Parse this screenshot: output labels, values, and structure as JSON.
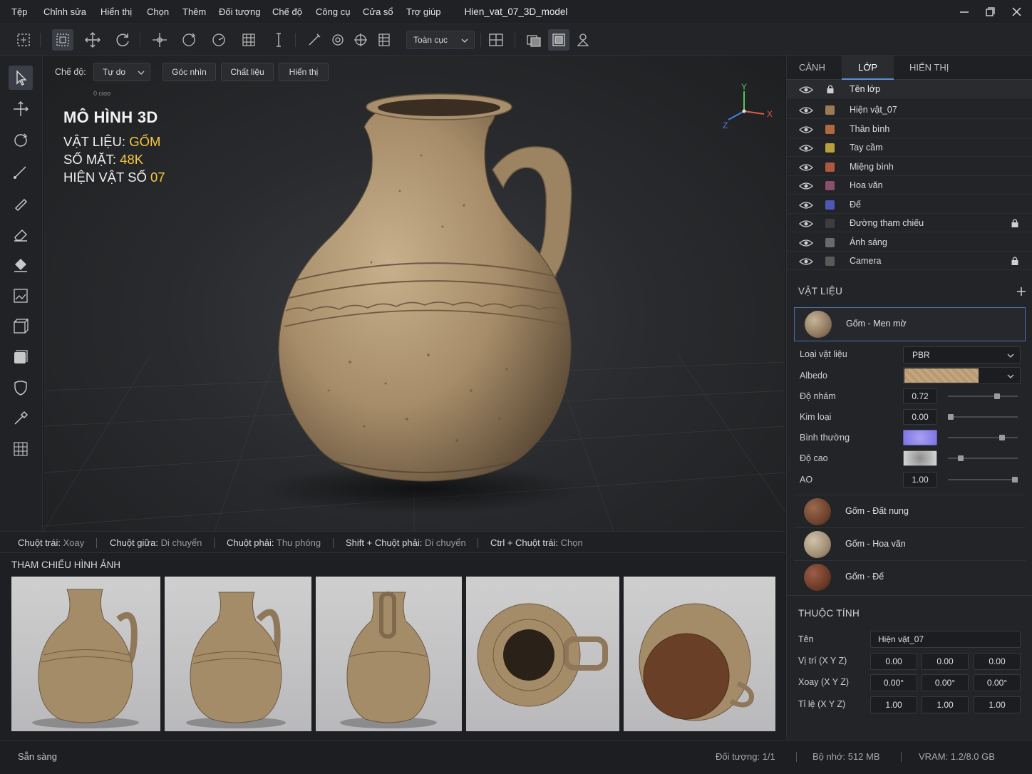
{
  "menubar": {
    "items": [
      "Tệp",
      "Chỉnh sửa",
      "Hiển thị",
      "Chọn",
      "Thêm",
      "Đối tượng",
      "Chế độ",
      "Công cụ",
      "Cửa sổ",
      "Trợ giúp"
    ],
    "title": "Hien_vat_07_3D_model"
  },
  "toolbar": {
    "scope_value": "Toàn cục"
  },
  "viewport": {
    "mode_label": "Chế độ:",
    "mode_value": "Tự do",
    "buttons": [
      "Góc nhìn",
      "Chất liệu",
      "Hiển thị"
    ],
    "small_text": "0 cioo",
    "info": {
      "title": "MÔ HÌNH 3D",
      "material_label": "VẬT LIỆU:",
      "material_value": "GỐM",
      "faces_label": "SỐ MẶT:",
      "faces_value": "48K",
      "artifact_label": "HIỆN VẬT SỐ",
      "artifact_value": "07"
    },
    "axes": {
      "x": "X",
      "y": "Y",
      "z": "Z"
    }
  },
  "hints": [
    {
      "key": "Chuột trái:",
      "action": "Xoay"
    },
    {
      "key": "Chuột giữa:",
      "action": "Di chuyển"
    },
    {
      "key": "Chuột phải:",
      "action": "Thu phóng"
    },
    {
      "key": "Shift + Chuột phải:",
      "action": "Di chuyển"
    },
    {
      "key": "Ctrl + Chuột trái:",
      "action": "Chọn"
    }
  ],
  "references": {
    "title": "THAM CHIẾU HÌNH ẢNH"
  },
  "panel": {
    "tabs": [
      "CẢNH",
      "LỚP",
      "HIỂN THỊ"
    ],
    "layer_header": "Tên lớp",
    "layers": [
      {
        "name": "Hiện vật_07",
        "color": "#9c7a55",
        "locked": false
      },
      {
        "name": "Thân bình",
        "color": "#b0683e",
        "locked": false
      },
      {
        "name": "Tay cầm",
        "color": "#b8a13a",
        "locked": false
      },
      {
        "name": "Miệng bình",
        "color": "#b0573f",
        "locked": false
      },
      {
        "name": "Hoa văn",
        "color": "#8a4f6e",
        "locked": false
      },
      {
        "name": "Đế",
        "color": "#4f58b8",
        "locked": false
      },
      {
        "name": "Đường tham chiếu",
        "color": "#3d3d40",
        "locked": true
      },
      {
        "name": "Ánh sáng",
        "color": "#6a6a6a",
        "locked": false
      },
      {
        "name": "Camera",
        "color": "#5a5a5a",
        "locked": true
      }
    ],
    "materials_title": "VẬT LIỆU",
    "selected_material": "Gốm - Men mờ",
    "props": {
      "type_label": "Loại vật liệu",
      "type_value": "PBR",
      "albedo_label": "Albedo",
      "roughness_label": "Độ nhám",
      "roughness_value": "0.72",
      "metal_label": "Kim loại",
      "metal_value": "0.00",
      "normal_label": "Bình thường",
      "height_label": "Độ cao",
      "ao_label": "AO",
      "ao_value": "1.00"
    },
    "slider_levels": {
      "roughness": 0.72,
      "metal": 0.0,
      "normal": 0.8,
      "height": 0.15,
      "ao": 1.0
    },
    "other_materials": [
      "Gốm - Đất nung",
      "Gốm - Hoa văn",
      "Gốm - Đế"
    ],
    "attributes_title": "THUỘC TÍNH",
    "name_label": "Tên",
    "name_value": "Hiện vật_07",
    "position_label": "Vị trí  (X  Y  Z)",
    "position": [
      "0.00",
      "0.00",
      "0.00"
    ],
    "rotation_label": "Xoay  (X  Y  Z)",
    "rotation": [
      "0.00°",
      "0.00°",
      "0.00°"
    ],
    "scale_label": "Tỉ lệ  (X  Y  Z)",
    "scale": [
      "1.00",
      "1.00",
      "1.00"
    ]
  },
  "status": {
    "left": "Sẵn sàng",
    "objects": "Đối tượng:  1/1",
    "memory": "Bộ nhớ:  512 MB",
    "vram": "VRAM:  1.2/8.0 GB"
  }
}
